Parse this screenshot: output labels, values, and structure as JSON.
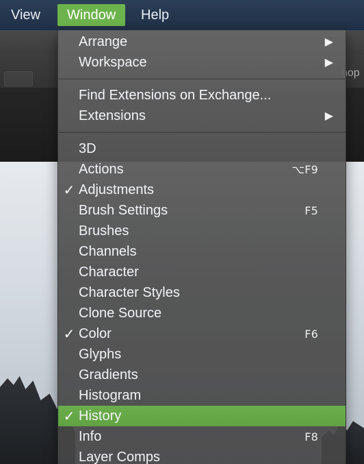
{
  "menubar": {
    "items": [
      {
        "label": "View"
      },
      {
        "label": "Window"
      },
      {
        "label": "Help"
      }
    ]
  },
  "background": {
    "doc_tab_fragment": "hop"
  },
  "window_menu": {
    "rows": [
      {
        "label": "Arrange",
        "shortcut": "",
        "submenu": "▶",
        "check": ""
      },
      {
        "label": "Workspace",
        "shortcut": "",
        "submenu": "▶",
        "check": ""
      },
      {
        "label": "Find Extensions on Exchange...",
        "shortcut": "",
        "submenu": "",
        "check": ""
      },
      {
        "label": "Extensions",
        "shortcut": "",
        "submenu": "▶",
        "check": ""
      },
      {
        "label": "3D",
        "shortcut": "",
        "submenu": "",
        "check": ""
      },
      {
        "label": "Actions",
        "shortcut": "⌥F9",
        "submenu": "",
        "check": ""
      },
      {
        "label": "Adjustments",
        "shortcut": "",
        "submenu": "",
        "check": "✓"
      },
      {
        "label": "Brush Settings",
        "shortcut": "F5",
        "submenu": "",
        "check": ""
      },
      {
        "label": "Brushes",
        "shortcut": "",
        "submenu": "",
        "check": ""
      },
      {
        "label": "Channels",
        "shortcut": "",
        "submenu": "",
        "check": ""
      },
      {
        "label": "Character",
        "shortcut": "",
        "submenu": "",
        "check": ""
      },
      {
        "label": "Character Styles",
        "shortcut": "",
        "submenu": "",
        "check": ""
      },
      {
        "label": "Clone Source",
        "shortcut": "",
        "submenu": "",
        "check": ""
      },
      {
        "label": "Color",
        "shortcut": "F6",
        "submenu": "",
        "check": "✓"
      },
      {
        "label": "Glyphs",
        "shortcut": "",
        "submenu": "",
        "check": ""
      },
      {
        "label": "Gradients",
        "shortcut": "",
        "submenu": "",
        "check": ""
      },
      {
        "label": "Histogram",
        "shortcut": "",
        "submenu": "",
        "check": ""
      },
      {
        "label": "History",
        "shortcut": "",
        "submenu": "",
        "check": "✓",
        "highlighted": true
      },
      {
        "label": "Info",
        "shortcut": "F8",
        "submenu": "",
        "check": ""
      },
      {
        "label": "Layer Comps",
        "shortcut": "",
        "submenu": "",
        "check": ""
      }
    ]
  },
  "colors": {
    "accent_green": "#6db34d",
    "menubar_blue": "#2c3f58"
  }
}
